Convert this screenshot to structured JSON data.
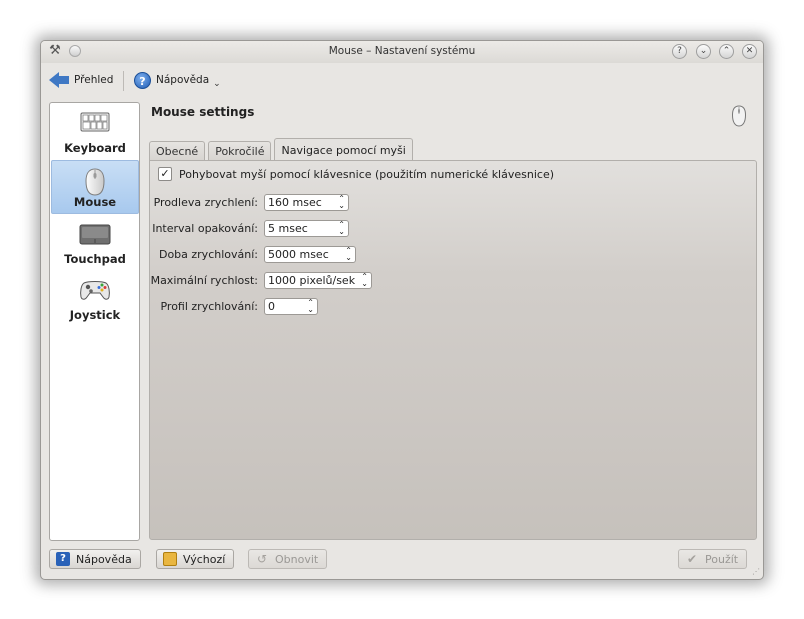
{
  "window": {
    "title": "Mouse – Nastavení systému",
    "buttons": [
      "?",
      "⌄",
      "⌃",
      "✕"
    ]
  },
  "toolbar": {
    "overview_label": "Přehled",
    "help_label": "Nápověda",
    "help_chevron": "⌄"
  },
  "sidebar": {
    "items": [
      {
        "label": "Keyboard",
        "icon": "keyboard-icon",
        "active": false
      },
      {
        "label": "Mouse",
        "icon": "mouse-icon",
        "active": true
      },
      {
        "label": "Touchpad",
        "icon": "touchpad-icon",
        "active": false
      },
      {
        "label": "Joystick",
        "icon": "joystick-icon",
        "active": false
      }
    ]
  },
  "header": {
    "title": "Mouse settings",
    "icon": "mouse-icon"
  },
  "tabs": [
    {
      "label": "Obecné",
      "active": false
    },
    {
      "label": "Pokročilé",
      "active": false
    },
    {
      "label": "Navigace pomocí myši",
      "active": true
    }
  ],
  "panel": {
    "checkbox_label": "Pohybovat myší pomocí klávesnice (použitím numerické klávesnice)",
    "checkbox_checked": true,
    "fields": [
      {
        "label": "Prodleva zrychlení:",
        "value": "160 msec"
      },
      {
        "label": "Interval opakování:",
        "value": "5 msec"
      },
      {
        "label": "Doba zrychlování:",
        "value": "5000 msec"
      },
      {
        "label": "Maximální rychlost:",
        "value": "1000 pixelů/sek"
      },
      {
        "label": "Profil zrychlování:",
        "value": "0"
      }
    ]
  },
  "bottom": {
    "help_label": "Nápověda",
    "default_label": "Výchozí",
    "reset_label": "Obnovit",
    "apply_label": "Použít"
  },
  "colors": {
    "accent": "#3f78c4",
    "selection": "#a8c9ee"
  }
}
